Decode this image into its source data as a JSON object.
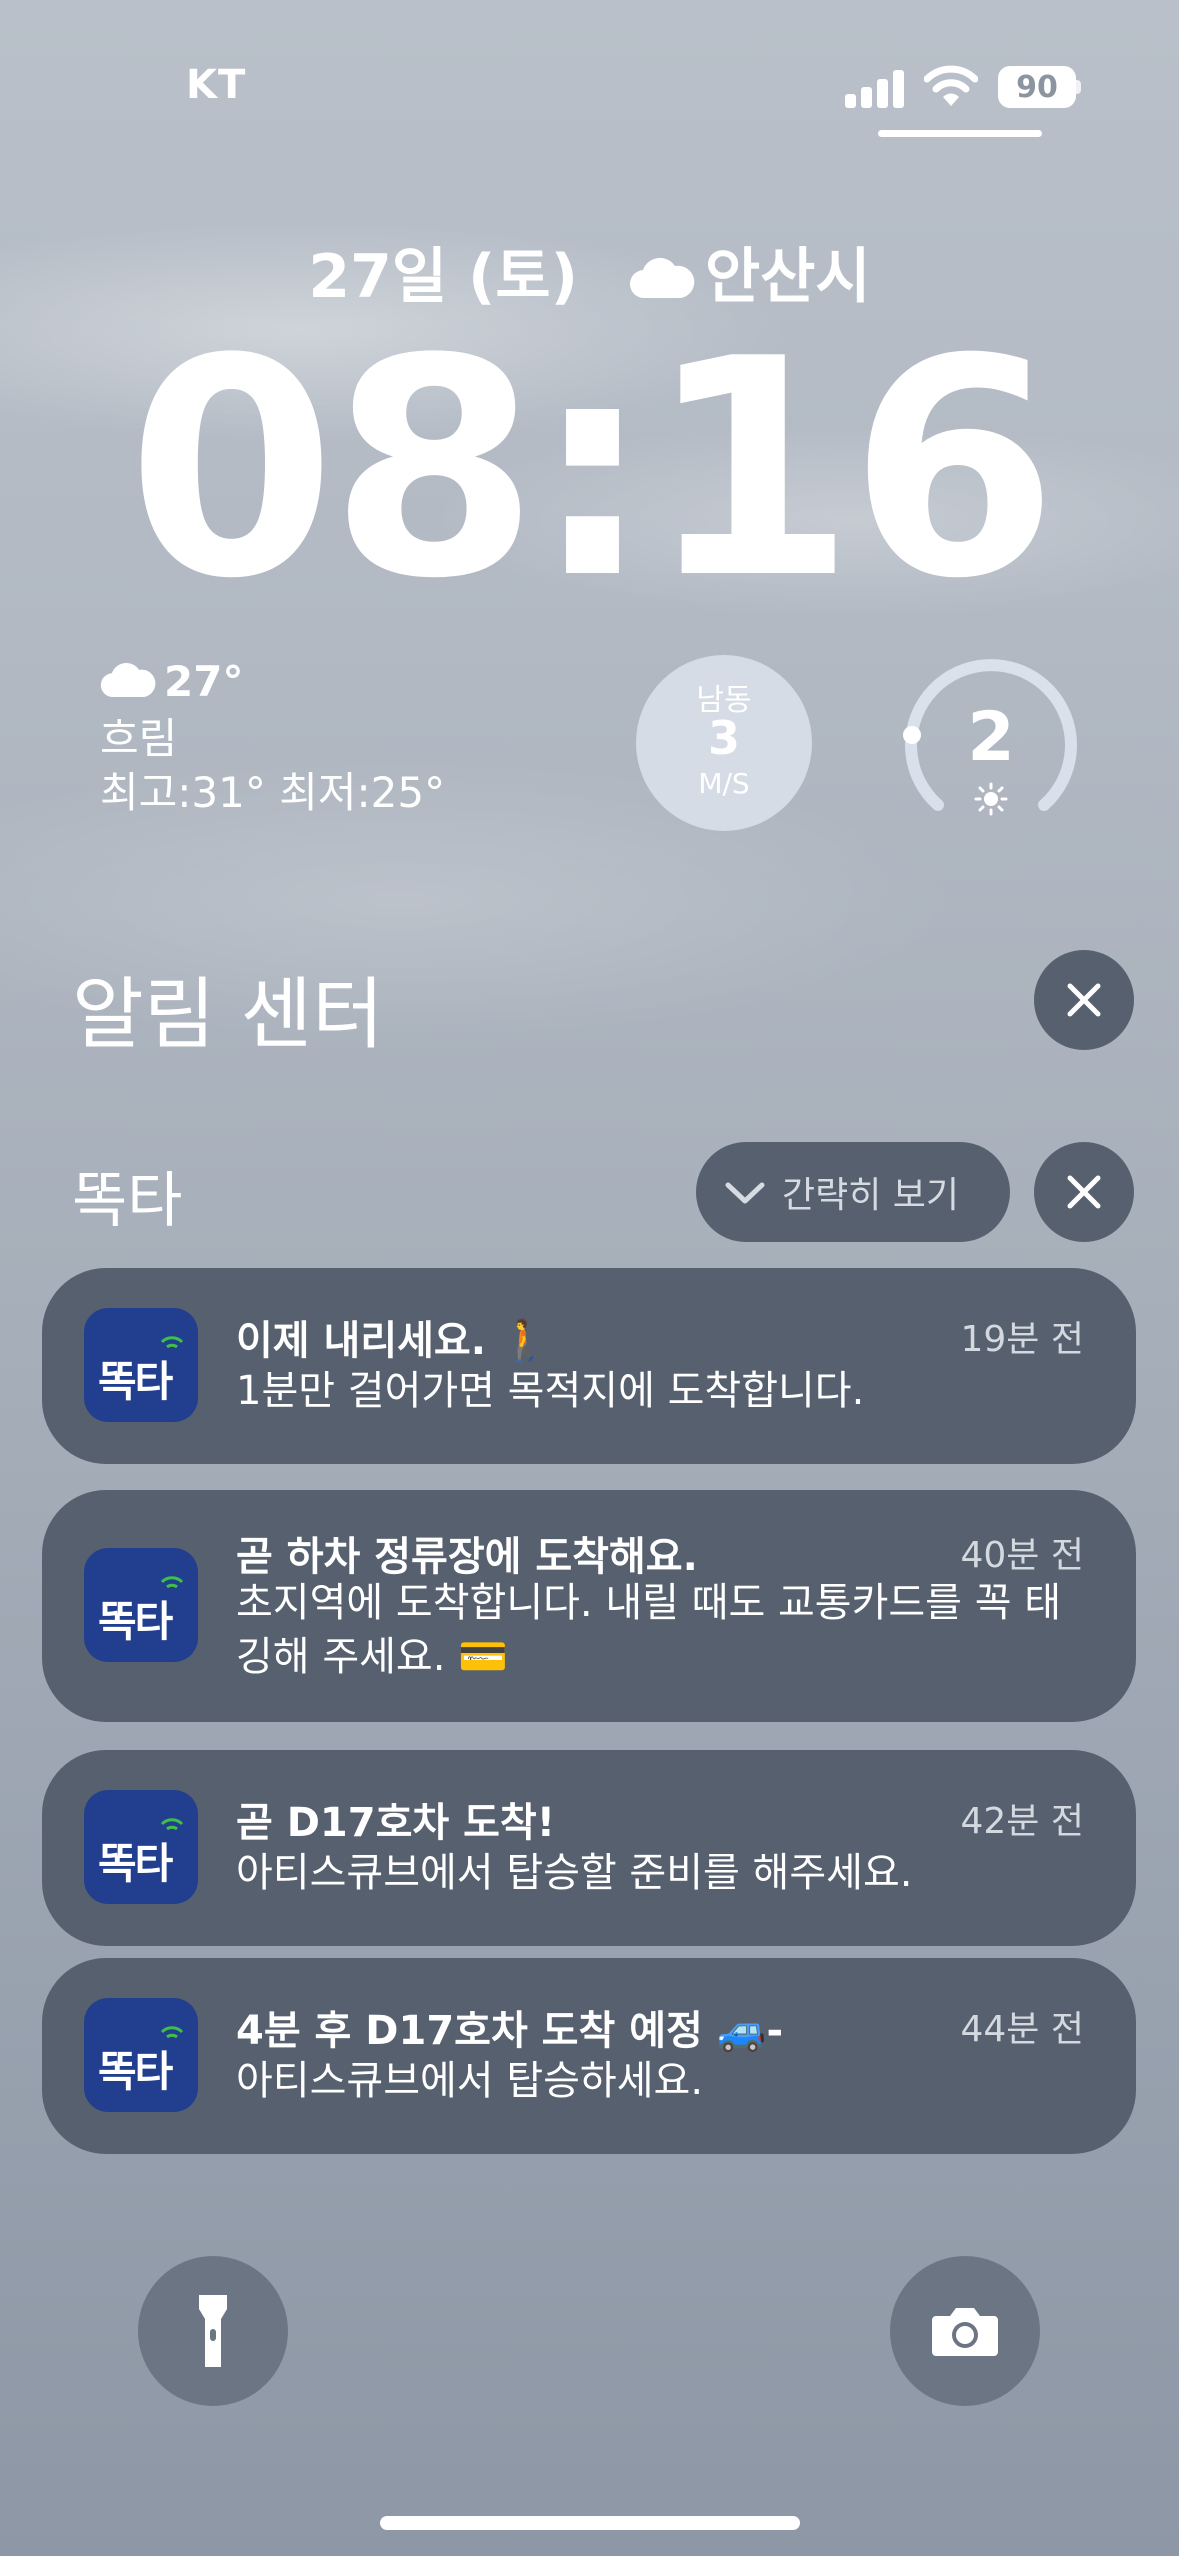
{
  "status_bar": {
    "carrier": "KT",
    "battery": "90"
  },
  "lockscreen": {
    "date": "27일 (토)",
    "city": "안산시",
    "time": "08:16"
  },
  "weather": {
    "temp": "27°",
    "condition": "흐림",
    "high_low": "최고:31° 최저:25°",
    "icon": "cloud-icon"
  },
  "wind_widget": {
    "direction": "남동",
    "speed": "3",
    "unit": "M/S"
  },
  "uv_widget": {
    "value": "2",
    "level_fraction": 0.2,
    "icon": "sun-icon"
  },
  "notification_center": {
    "title": "알림 센터"
  },
  "app_group": {
    "name": "똑타",
    "collapse_label": "간략히 보기",
    "icon_text": "똑타"
  },
  "notifications": [
    {
      "title": "이제 내리세요. 🚶",
      "body": "1분만 걸어가면 목적지에 도착합니다.",
      "time": "19분 전"
    },
    {
      "title": "곧 하차 정류장에 도착해요.",
      "body": "초지역에 도착합니다. 내릴 때도 교통카드를 꼭 태깅해 주세요. 💳",
      "time": "40분 전"
    },
    {
      "title": "곧 D17호차 도착!",
      "body": "아티스큐브에서 탑승할 준비를 해주세요.",
      "time": "42분 전"
    },
    {
      "title": "4분 후 D17호차 도착 예정 🚙-",
      "body": "아티스큐브에서 탑승하세요.",
      "time": "44분 전"
    }
  ]
}
